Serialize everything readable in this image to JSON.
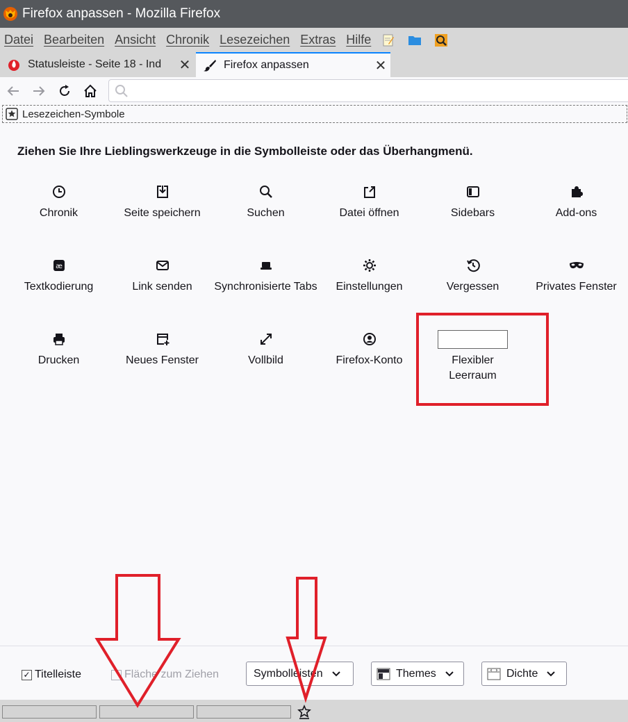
{
  "window": {
    "title": "Firefox anpassen - Mozilla Firefox"
  },
  "menubar": {
    "items": [
      "Datei",
      "Bearbeiten",
      "Ansicht",
      "Chronik",
      "Lesezeichen",
      "Extras",
      "Hilfe"
    ],
    "extra_icons": [
      "notepad-icon",
      "folder-icon",
      "search-magnifier-icon"
    ]
  },
  "tabs": [
    {
      "title": "Statusleiste - Seite 18 - Ind",
      "icon": "flame-icon"
    },
    {
      "title": "Firefox anpassen",
      "icon": "paintbrush-icon",
      "active": true
    }
  ],
  "bookmarks_toolbar": {
    "label": "Lesezeichen-Symbole"
  },
  "customize": {
    "instruction": "Ziehen Sie Ihre Lieblingswerkzeuge in die Symbolleiste oder das Überhangmenü.",
    "tools": [
      {
        "label": "Chronik",
        "icon": "clock-icon"
      },
      {
        "label": "Seite speichern",
        "icon": "save-page-icon"
      },
      {
        "label": "Suchen",
        "icon": "search-icon"
      },
      {
        "label": "Datei öffnen",
        "icon": "open-file-icon"
      },
      {
        "label": "Sidebars",
        "icon": "sidebar-icon"
      },
      {
        "label": "Add-ons",
        "icon": "puzzle-icon"
      },
      {
        "label": "Textkodierung",
        "icon": "text-encoding-icon"
      },
      {
        "label": "Link senden",
        "icon": "mail-icon"
      },
      {
        "label": "Synchronisierte Tabs",
        "icon": "synced-tabs-icon"
      },
      {
        "label": "Einstellungen",
        "icon": "gear-icon"
      },
      {
        "label": "Vergessen",
        "icon": "forget-icon"
      },
      {
        "label": "Privates Fenster",
        "icon": "mask-icon"
      },
      {
        "label": "Drucken",
        "icon": "printer-icon"
      },
      {
        "label": "Neues Fenster",
        "icon": "new-window-icon"
      },
      {
        "label": "Vollbild",
        "icon": "fullscreen-icon"
      },
      {
        "label": "Firefox-Konto",
        "icon": "account-icon"
      },
      {
        "label": "Flexibler Leerraum",
        "icon": "flexible-space-box"
      }
    ]
  },
  "footer": {
    "titlebar_label": "Titelleiste",
    "titlebar_checked": true,
    "drag_space_label": "Fläche zum Ziehen",
    "drag_space_checked": false,
    "toolbars_button": "Symbolleisten",
    "themes_button": "Themes",
    "density_button": "Dichte"
  },
  "colors": {
    "highlight": "#e0202a",
    "titlebar": "#55585c",
    "chrome": "#d7d7d7",
    "accent": "#0a84ff"
  }
}
